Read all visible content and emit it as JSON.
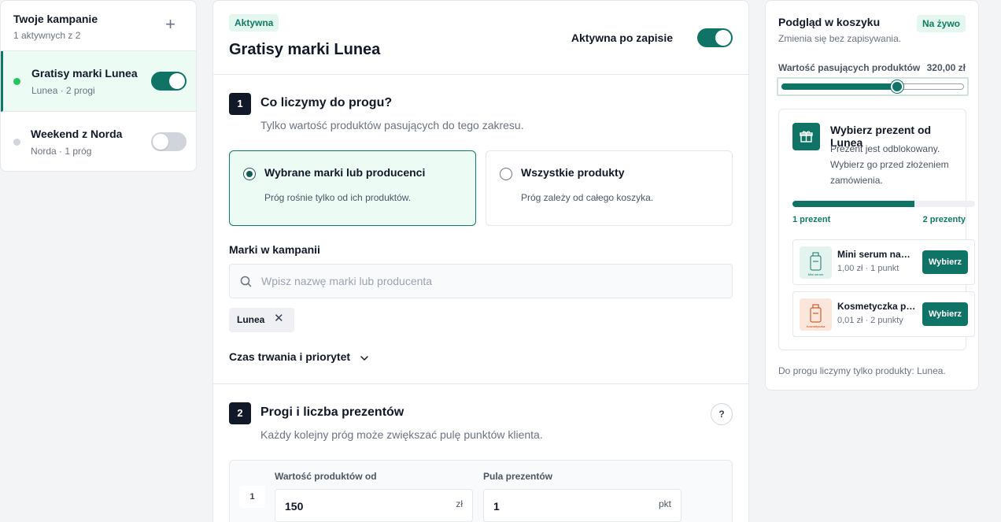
{
  "sidebar": {
    "title": "Twoje kampanie",
    "subtitle": "1 aktywnych z 2",
    "add_label": "+",
    "campaigns": [
      {
        "name": "Gratisy marki Lunea",
        "meta": "Lunea · 2 progi",
        "active": true,
        "dot_color": "#22c55e"
      },
      {
        "name": "Weekend z Norda",
        "meta": "Norda · 1 próg",
        "active": false,
        "dot_color": "#d1d5db"
      }
    ]
  },
  "main": {
    "status_badge": "Aktywna",
    "title": "Gratisy marki Lunea",
    "active_after_save_label": "Aktywna po zapisie",
    "active_after_save": true,
    "step1": {
      "number": "1",
      "title": "Co liczymy do progu?",
      "description": "Tylko wartość produktów pasujących do tego zakresu.",
      "options": [
        {
          "label": "Wybrane marki lub producenci",
          "description": "Próg rośnie tylko od ich produktów.",
          "selected": true
        },
        {
          "label": "Wszystkie produkty",
          "description": "Próg zależy od całego koszyka.",
          "selected": false
        }
      ]
    },
    "brands": {
      "label": "Marki w kampanii",
      "placeholder": "Wpisz nazwę marki lub producenta",
      "chips": [
        {
          "label": "Lunea",
          "remove": "✕"
        }
      ]
    },
    "duration_label": "Czas trwania i priorytet",
    "step2": {
      "number": "2",
      "title": "Progi i liczba prezentów",
      "description": "Każdy kolejny próg może zwiększać pulę punktów klienta.",
      "help": "?",
      "tiers": [
        {
          "index": "1",
          "value_label": "Wartość produktów od",
          "value": "150",
          "value_unit": "zł",
          "pool_label": "Pula prezentów",
          "pool": "1",
          "pool_unit": "pkt"
        }
      ]
    }
  },
  "preview": {
    "title": "Podgląd w koszyku",
    "live_badge": "Na żywo",
    "subtitle": "Zmienia się bez zapisywania.",
    "value_label": "Wartość pasujących produktów",
    "value_amount": "320,00 zł",
    "slider_fraction": 0.635,
    "gift": {
      "title": "Wybierz prezent od Lunea",
      "description": "Prezent jest odblokowany. Wybierz go przed złożeniem zamówienia.",
      "progress_fraction": 0.67,
      "progress_left": "1 prezent",
      "progress_right": "2 prezenty",
      "products": [
        {
          "name": "Mini serum nawilżające",
          "meta": "1,00 zł · 1 punkt",
          "button": "Wybierz",
          "thumb_caption": "Mini serum",
          "thumb_bg": "#e3f4ee",
          "thumb_color": "#0f7366"
        },
        {
          "name": "Kosmetyczka podróżna",
          "meta": "0,01 zł · 2 punkty",
          "button": "Wybierz",
          "thumb_caption": "Kosmetyczka",
          "thumb_bg": "#fbe6dc",
          "thumb_color": "#c2410c"
        }
      ]
    },
    "footer": "Do progu liczymy tylko produkty: Lunea."
  },
  "colors": {
    "accent": "#0f7366",
    "accent_light": "#edfbf5",
    "badge_bg": "#e3f7ee"
  },
  "icons": {
    "add": "plus-icon",
    "search": "search-icon",
    "remove": "close-icon",
    "chevron": "chevron-down-icon",
    "gift": "gift-icon",
    "product": "bottle-icon",
    "help": "question-icon"
  }
}
